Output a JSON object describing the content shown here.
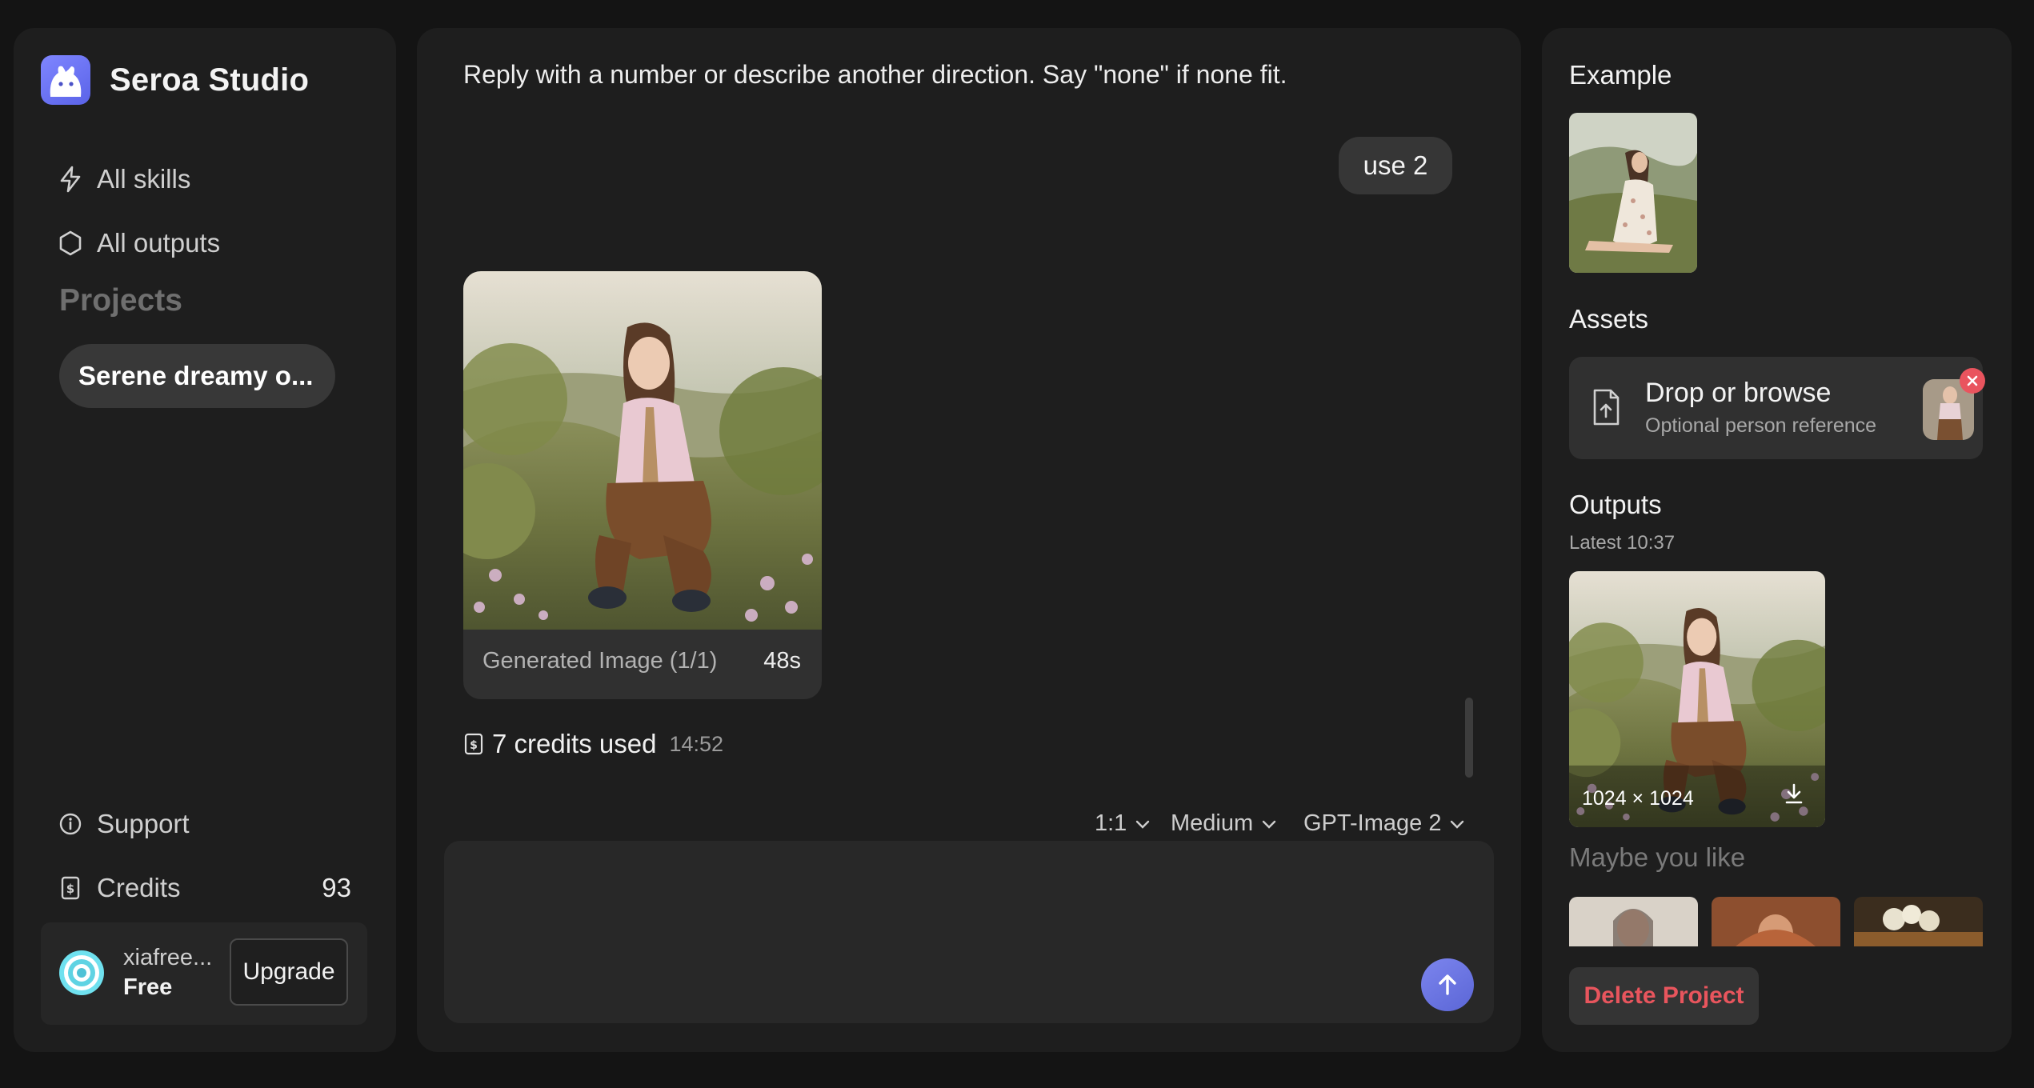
{
  "brand": {
    "name": "Seroa Studio"
  },
  "nav": {
    "all_skills": "All skills",
    "all_outputs": "All outputs",
    "projects_label": "Projects",
    "project_item": "Serene dreamy o...",
    "support": "Support",
    "credits_label": "Credits",
    "credits_count": "93"
  },
  "account": {
    "name": "xiafree...",
    "plan": "Free",
    "upgrade": "Upgrade"
  },
  "chat": {
    "assistant_text": "Reply with a number or describe another direction. Say \"none\" if none fit.",
    "user_message": "use 2",
    "generated": {
      "label": "Generated Image (1/1)",
      "time": "48s"
    },
    "credits_used": "7 credits used",
    "credits_time": "14:52"
  },
  "composer": {
    "ratio": "1:1",
    "quality": "Medium",
    "model": "GPT-Image 2",
    "placeholder": ""
  },
  "right": {
    "example_heading": "Example",
    "assets_heading": "Assets",
    "drop_title": "Drop or browse",
    "drop_sub": "Optional person reference",
    "outputs_heading": "Outputs",
    "outputs_sub": "Latest 10:37",
    "output_size": "1024 × 1024",
    "maybe_heading": "Maybe you like",
    "delete": "Delete Project"
  },
  "colors": {
    "accent": "#6a73ee",
    "danger": "#e8555d",
    "background": "#141414",
    "panel": "#1e1e1e"
  }
}
